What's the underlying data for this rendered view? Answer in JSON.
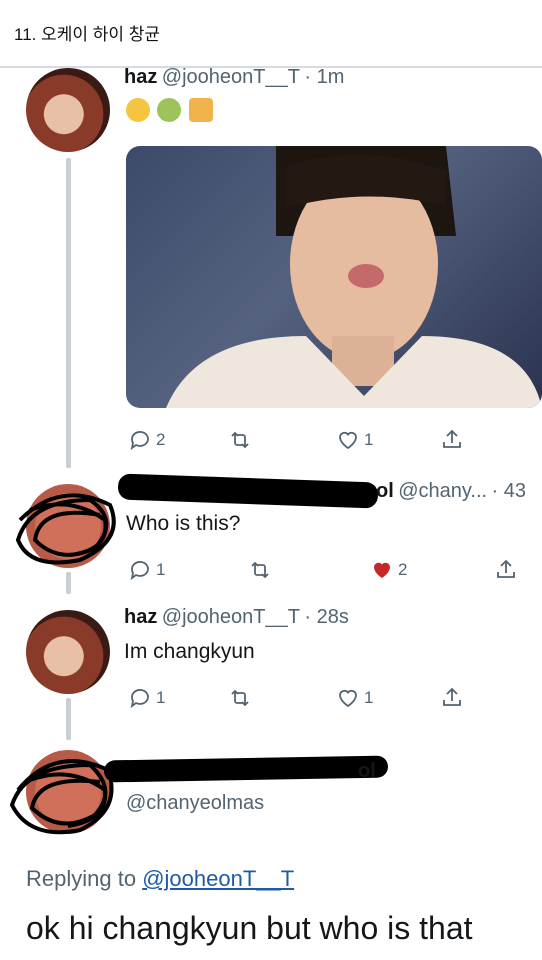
{
  "header": {
    "title": "11. 오케이 하이 창균"
  },
  "tweet1": {
    "name": "haz",
    "handle": "@jooheonT__T",
    "time": "· 1m",
    "emojis": [
      "pleading-face",
      "nauseated-face",
      "person-at-computer"
    ],
    "actions": {
      "replies": "2",
      "retweets": "",
      "likes": "1"
    }
  },
  "tweet2": {
    "name_suffix": "ol",
    "handle": "@chany...",
    "time": "· 43",
    "text": "Who is this?",
    "actions": {
      "replies": "1",
      "retweets": "",
      "likes": "2"
    },
    "like_color": "#c62828"
  },
  "tweet3": {
    "name": "haz",
    "handle": "@jooheonT__T",
    "time": "· 28s",
    "text": "Im changkyun",
    "actions": {
      "replies": "1",
      "retweets": "",
      "likes": "1"
    }
  },
  "compose": {
    "name_suffix": "ol",
    "handle": "@chanyeolmas",
    "replying_prefix": "Replying to",
    "replying_handle": "@jooheonT__T",
    "reply_text": "ok hi changkyun but who is that"
  },
  "colors": {
    "text": "#14171a",
    "muted": "#536471",
    "link": "#1d5ba8",
    "scribble": "#000000",
    "liked": "#c62828"
  }
}
